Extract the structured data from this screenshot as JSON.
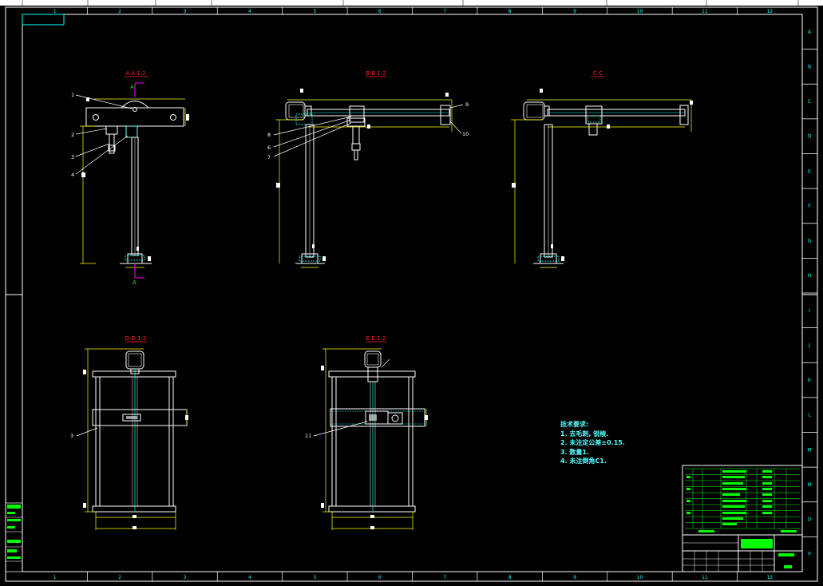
{
  "border": {
    "top_numbers": [
      "1",
      "2",
      "3",
      "4",
      "5",
      "6",
      "7",
      "8",
      "9",
      "10",
      "11",
      "12"
    ],
    "bottom_numbers": [
      "1",
      "2",
      "3",
      "4",
      "5",
      "6",
      "7",
      "8",
      "9",
      "10",
      "11",
      "12"
    ],
    "right_letters": [
      "A",
      "B",
      "C",
      "D",
      "E",
      "F",
      "G",
      "H",
      "I",
      "J",
      "K",
      "L",
      "M",
      "N",
      "O",
      "P"
    ]
  },
  "views": {
    "v1": {
      "title": "A-A 1:2"
    },
    "v2": {
      "title": "B-B 1:2"
    },
    "v3": {
      "title": "C-C"
    },
    "v4": {
      "title": "D-D 1:2"
    },
    "v5": {
      "title": "E-E 1:2"
    }
  },
  "section_mark": "A",
  "balloons": {
    "v1": [
      "1",
      "2",
      "3",
      "4"
    ],
    "v2": [
      "8",
      "6",
      "7",
      "9",
      "10"
    ],
    "v4": [
      "3"
    ],
    "v5": [
      "11"
    ]
  },
  "notes": {
    "title": "技术要求:",
    "items": [
      "1. 去毛刺, 锐棱.",
      "2. 未注定公差±0.15.",
      "3. 数量1.",
      "4. 未注倒角C1."
    ]
  },
  "colors": {
    "frame": "#ffffff",
    "outline": "#ffffff",
    "dimension": "#ffff00",
    "title_red": "#ff2222",
    "leader": "#00ff00",
    "notes": "#55ffff",
    "hatch": "#00ffff",
    "section_mark": "#ff00ff"
  }
}
